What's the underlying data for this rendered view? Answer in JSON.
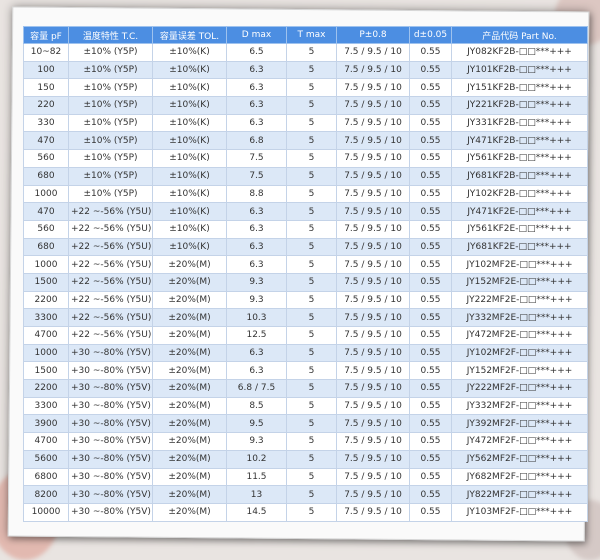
{
  "table": {
    "headers": [
      "容量 pF",
      "温度特性 T.C.",
      "容量误差 TOL.",
      "D max",
      "T max",
      "P±0.8",
      "d±0.05",
      "产品代码 Part No."
    ],
    "rows": [
      [
        "10~82",
        "±10%   (Y5P)",
        "±10%(K)",
        "6.5",
        "5",
        "7.5 / 9.5 / 10",
        "0.55",
        "JY082KF2B-□□***+++"
      ],
      [
        "100",
        "±10%   (Y5P)",
        "±10%(K)",
        "6.3",
        "5",
        "7.5 / 9.5 / 10",
        "0.55",
        "JY101KF2B-□□***+++"
      ],
      [
        "150",
        "±10%   (Y5P)",
        "±10%(K)",
        "6.3",
        "5",
        "7.5 / 9.5 / 10",
        "0.55",
        "JY151KF2B-□□***+++"
      ],
      [
        "220",
        "±10%   (Y5P)",
        "±10%(K)",
        "6.3",
        "5",
        "7.5 / 9.5 / 10",
        "0.55",
        "JY221KF2B-□□***+++"
      ],
      [
        "330",
        "±10%   (Y5P)",
        "±10%(K)",
        "6.3",
        "5",
        "7.5 / 9.5 / 10",
        "0.55",
        "JY331KF2B-□□***+++"
      ],
      [
        "470",
        "±10%   (Y5P)",
        "±10%(K)",
        "6.8",
        "5",
        "7.5 / 9.5 / 10",
        "0.55",
        "JY471KF2B-□□***+++"
      ],
      [
        "560",
        "±10%   (Y5P)",
        "±10%(K)",
        "7.5",
        "5",
        "7.5 / 9.5 / 10",
        "0.55",
        "JY561KF2B-□□***+++"
      ],
      [
        "680",
        "±10%   (Y5P)",
        "±10%(K)",
        "7.5",
        "5",
        "7.5 / 9.5 / 10",
        "0.55",
        "JY681KF2B-□□***+++"
      ],
      [
        "1000",
        "±10%   (Y5P)",
        "±10%(K)",
        "8.8",
        "5",
        "7.5 / 9.5 / 10",
        "0.55",
        "JY102KF2B-□□***+++"
      ],
      [
        "470",
        "+22 ~-56% (Y5U)",
        "±10%(K)",
        "6.3",
        "5",
        "7.5 / 9.5 / 10",
        "0.55",
        "JY471KF2E-□□***+++"
      ],
      [
        "560",
        "+22 ~-56% (Y5U)",
        "±10%(K)",
        "6.3",
        "5",
        "7.5 / 9.5 / 10",
        "0.55",
        "JY561KF2E-□□***+++"
      ],
      [
        "680",
        "+22 ~-56% (Y5U)",
        "±10%(K)",
        "6.3",
        "5",
        "7.5 / 9.5 / 10",
        "0.55",
        "JY681KF2E-□□***+++"
      ],
      [
        "1000",
        "+22 ~-56% (Y5U)",
        "±20%(M)",
        "6.3",
        "5",
        "7.5 / 9.5 / 10",
        "0.55",
        "JY102MF2E-□□***+++"
      ],
      [
        "1500",
        "+22 ~-56% (Y5U)",
        "±20%(M)",
        "9.3",
        "5",
        "7.5 / 9.5 / 10",
        "0.55",
        "JY152MF2E-□□***+++"
      ],
      [
        "2200",
        "+22 ~-56% (Y5U)",
        "±20%(M)",
        "9.3",
        "5",
        "7.5 / 9.5 / 10",
        "0.55",
        "JY222MF2E-□□***+++"
      ],
      [
        "3300",
        "+22 ~-56% (Y5U)",
        "±20%(M)",
        "10.3",
        "5",
        "7.5 / 9.5 / 10",
        "0.55",
        "JY332MF2E-□□***+++"
      ],
      [
        "4700",
        "+22 ~-56% (Y5U)",
        "±20%(M)",
        "12.5",
        "5",
        "7.5 / 9.5 / 10",
        "0.55",
        "JY472MF2E-□□***+++"
      ],
      [
        "1000",
        "+30 ~-80% (Y5V)",
        "±20%(M)",
        "6.3",
        "5",
        "7.5 / 9.5 / 10",
        "0.55",
        "JY102MF2F-□□***+++"
      ],
      [
        "1500",
        "+30 ~-80% (Y5V)",
        "±20%(M)",
        "6.3",
        "5",
        "7.5 / 9.5 / 10",
        "0.55",
        "JY152MF2F-□□***+++"
      ],
      [
        "2200",
        "+30 ~-80% (Y5V)",
        "±20%(M)",
        "6.8 / 7.5",
        "5",
        "7.5 / 9.5 / 10",
        "0.55",
        "JY222MF2F-□□***+++"
      ],
      [
        "3300",
        "+30 ~-80% (Y5V)",
        "±20%(M)",
        "8.5",
        "5",
        "7.5 / 9.5 / 10",
        "0.55",
        "JY332MF2F-□□***+++"
      ],
      [
        "3900",
        "+30 ~-80% (Y5V)",
        "±20%(M)",
        "9.5",
        "5",
        "7.5 / 9.5 / 10",
        "0.55",
        "JY392MF2F-□□***+++"
      ],
      [
        "4700",
        "+30 ~-80% (Y5V)",
        "±20%(M)",
        "9.3",
        "5",
        "7.5 / 9.5 / 10",
        "0.55",
        "JY472MF2F-□□***+++"
      ],
      [
        "5600",
        "+30 ~-80% (Y5V)",
        "±20%(M)",
        "10.2",
        "5",
        "7.5 / 9.5 / 10",
        "0.55",
        "JY562MF2F-□□***+++"
      ],
      [
        "6800",
        "+30 ~-80% (Y5V)",
        "±20%(M)",
        "11.5",
        "5",
        "7.5 / 9.5 / 10",
        "0.55",
        "JY682MF2F-□□***+++"
      ],
      [
        "8200",
        "+30 ~-80% (Y5V)",
        "±20%(M)",
        "13",
        "5",
        "7.5 / 9.5 / 10",
        "0.55",
        "JY822MF2F-□□***+++"
      ],
      [
        "10000",
        "+30 ~-80% (Y5V)",
        "±20%(M)",
        "14.5",
        "5",
        "7.5 / 9.5 / 10",
        "0.55",
        "JY103MF2F-□□***+++"
      ]
    ]
  },
  "colors": {
    "header_bg": "#4c8ee2",
    "row_alt_bg": "#dce8f7",
    "row_bg": "#ffffff",
    "page_bg": "#e9e4e1"
  }
}
